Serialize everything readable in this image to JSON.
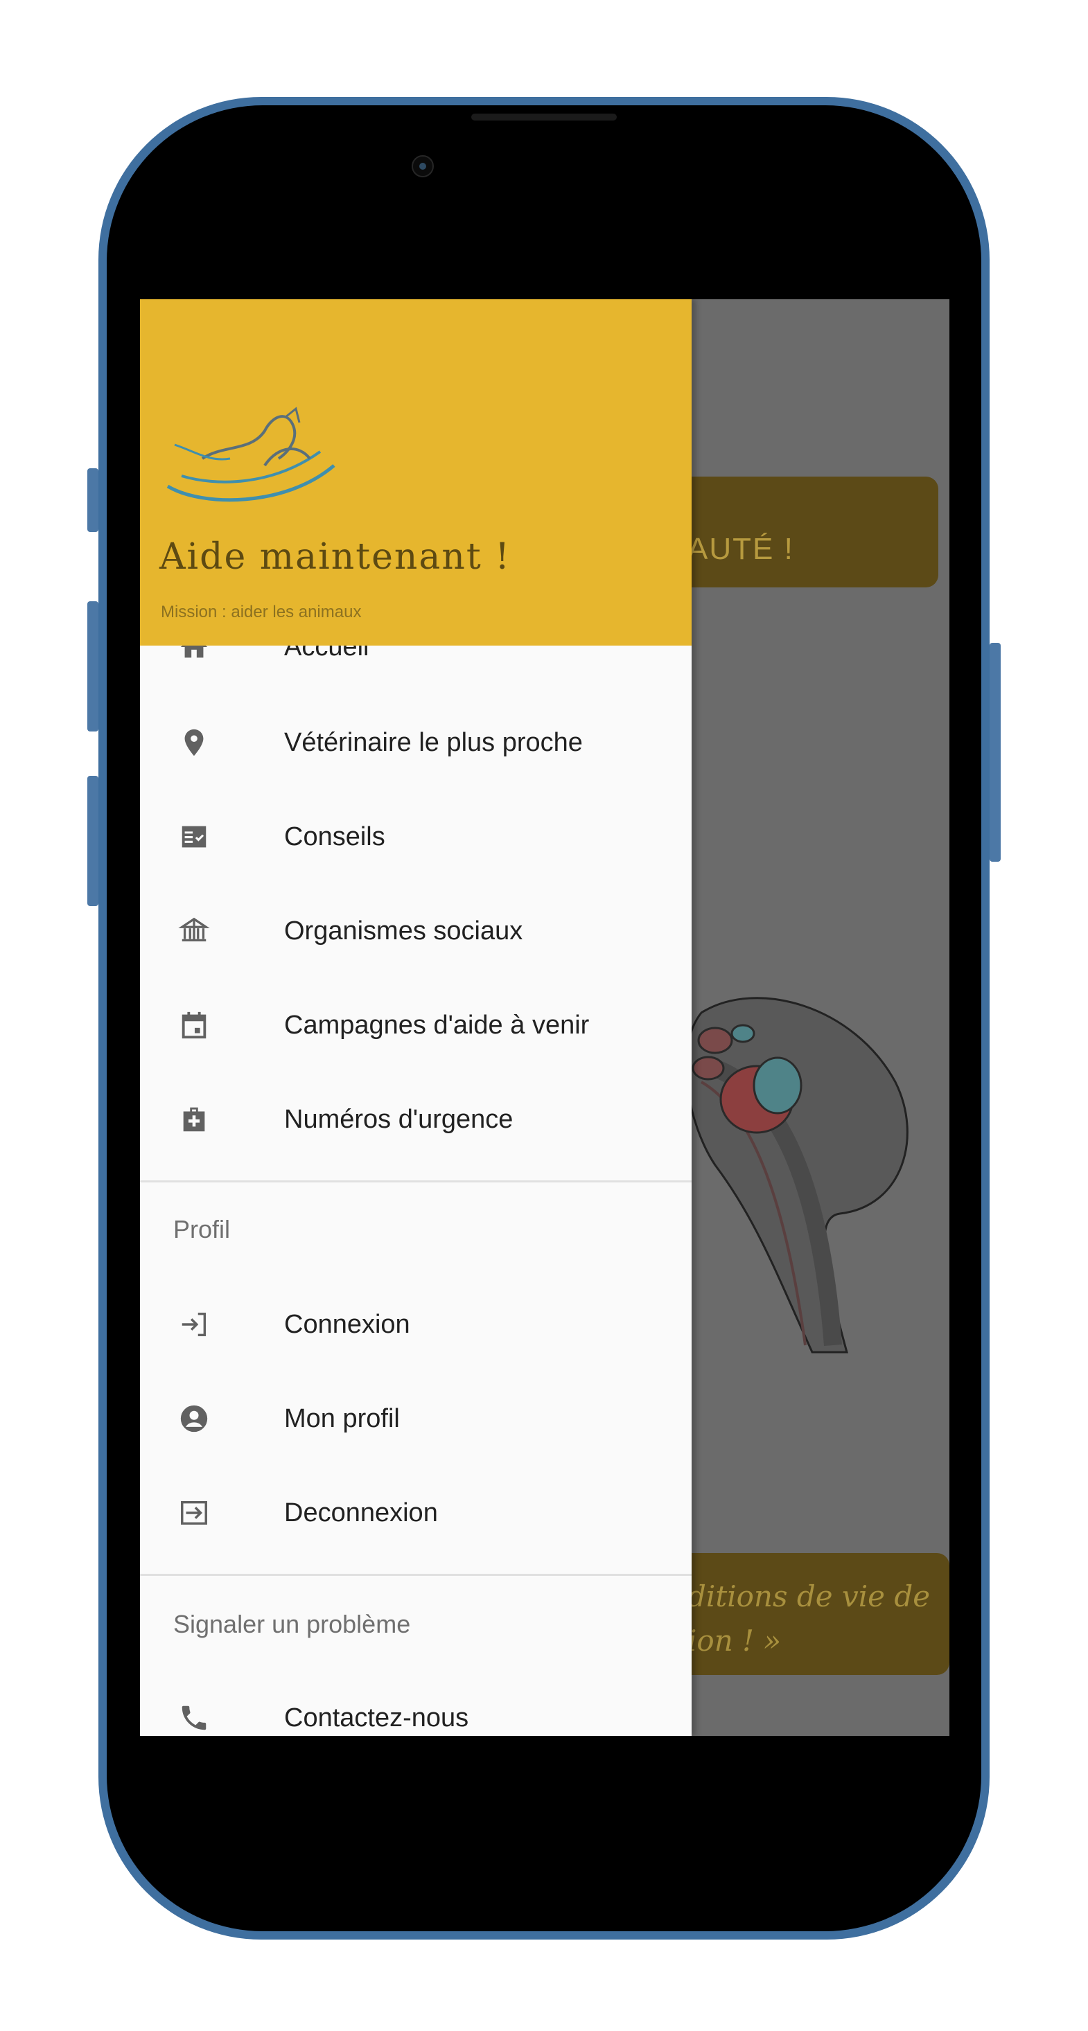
{
  "app": {
    "title": "Aide maintenant !",
    "subtitle": "Mission : aider les animaux",
    "accent_color": "#e6b62e"
  },
  "background_screen": {
    "banner_text": "AUTÉ !",
    "bottom_line1": "ditions de vie de",
    "bottom_line2": "ion ! »"
  },
  "drawer": {
    "items": [
      {
        "label": "Accueil",
        "icon": "home-icon"
      },
      {
        "label": "Vétérinaire le plus proche",
        "icon": "location-pin-icon"
      },
      {
        "label": "Conseils",
        "icon": "checklist-icon"
      },
      {
        "label": "Organismes sociaux",
        "icon": "social-organization-icon"
      },
      {
        "label": "Campagnes d'aide à venir",
        "icon": "calendar-icon"
      },
      {
        "label": "Numéros d'urgence",
        "icon": "medical-kit-icon"
      }
    ],
    "profile_section": {
      "title": "Profil",
      "items": [
        {
          "label": "Connexion",
          "icon": "login-icon"
        },
        {
          "label": "Mon profil",
          "icon": "account-circle-icon"
        },
        {
          "label": "Deconnexion",
          "icon": "logout-icon"
        }
      ]
    },
    "report_section": {
      "title": "Signaler un problème",
      "items": [
        {
          "label": "Contactez-nous",
          "icon": "phone-icon"
        }
      ]
    }
  }
}
